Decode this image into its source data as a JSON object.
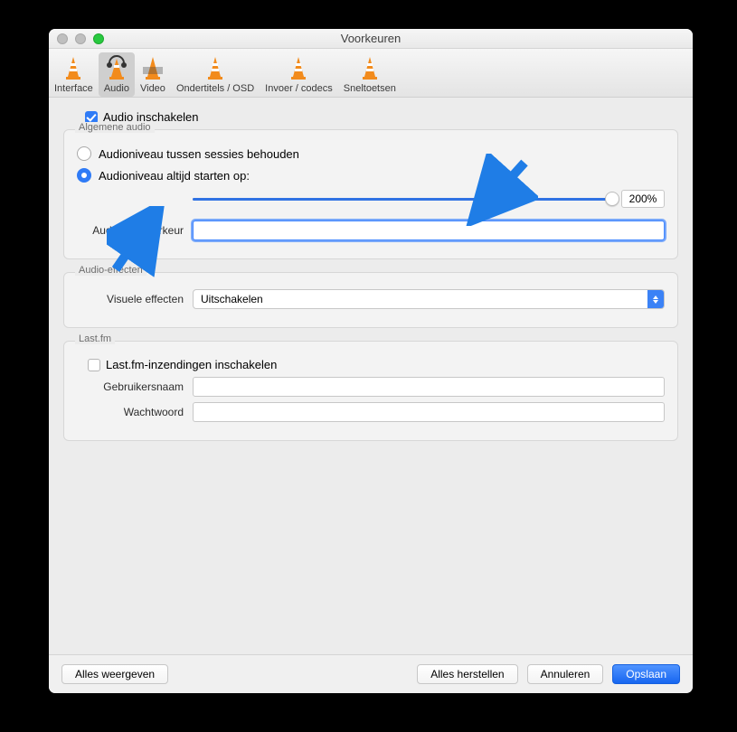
{
  "window": {
    "title": "Voorkeuren"
  },
  "toolbar": {
    "items": [
      {
        "label": "Interface"
      },
      {
        "label": "Audio"
      },
      {
        "label": "Video"
      },
      {
        "label": "Ondertitels / OSD"
      },
      {
        "label": "Invoer / codecs"
      },
      {
        "label": "Sneltoetsen"
      }
    ],
    "selected": 1
  },
  "audio": {
    "enable_label": "Audio inschakelen",
    "enable_checked": true,
    "general_legend": "Algemene audio",
    "radio_keep": "Audioniveau tussen sessies behouden",
    "radio_start": "Audioniveau altijd starten op:",
    "radio_selected": 1,
    "slider_percent": "200%",
    "lang_label": "Audiotaal-voorkeur",
    "lang_value": ""
  },
  "effects": {
    "legend": "Audio-effecten",
    "visual_label": "Visuele effecten",
    "visual_value": "Uitschakelen"
  },
  "lastfm": {
    "legend": "Last.fm",
    "enable_label": "Last.fm-inzendingen inschakelen",
    "enable_checked": false,
    "user_label": "Gebruikersnaam",
    "user_value": "",
    "pass_label": "Wachtwoord",
    "pass_value": ""
  },
  "footer": {
    "show_all": "Alles weergeven",
    "reset_all": "Alles herstellen",
    "cancel": "Annuleren",
    "save": "Opslaan"
  }
}
